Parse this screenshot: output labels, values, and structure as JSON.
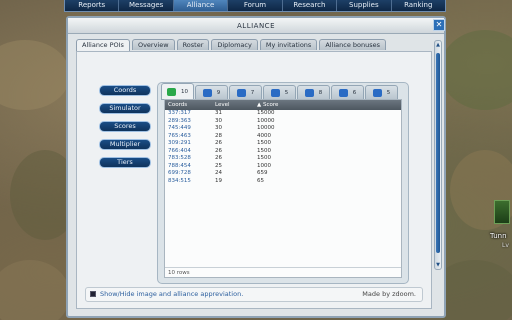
{
  "nav": {
    "tabs": [
      "Reports",
      "Messages",
      "Alliance",
      "Forum",
      "Research",
      "Supplies",
      "Ranking"
    ],
    "active_index": 2
  },
  "window": {
    "title": "ALLIANCE",
    "close_glyph": "✕"
  },
  "main_tabs": [
    {
      "label": "Alliance POIs",
      "active": true
    },
    {
      "label": "Overview",
      "active": false
    },
    {
      "label": "Roster",
      "active": false
    },
    {
      "label": "Diplomacy",
      "active": false
    },
    {
      "label": "My invitations",
      "active": false
    },
    {
      "label": "Alliance bonuses",
      "active": false
    }
  ],
  "side_buttons": [
    "Coords",
    "Simulator",
    "Scores",
    "Multiplier",
    "Tiers"
  ],
  "poi_tabs": [
    {
      "icon": "tiberium-icon",
      "count": "10",
      "color": "#2aa84a",
      "active": true
    },
    {
      "icon": "crystal-icon",
      "count": "9",
      "color": "#2a6bc4",
      "active": false
    },
    {
      "icon": "reactor-icon",
      "count": "7",
      "color": "#2a6bc4",
      "active": false
    },
    {
      "icon": "infantry-icon",
      "count": "5",
      "color": "#2a6bc4",
      "active": false
    },
    {
      "icon": "vehicle-icon",
      "count": "8",
      "color": "#2a6bc4",
      "active": false
    },
    {
      "icon": "aircraft-icon",
      "count": "6",
      "color": "#2a6bc4",
      "active": false
    },
    {
      "icon": "defense-icon",
      "count": "5",
      "color": "#2a6bc4",
      "active": false
    }
  ],
  "grid": {
    "headers": [
      "Coords",
      "Level",
      "▲ Score"
    ],
    "rows": [
      [
        "337:317",
        "31",
        "15000"
      ],
      [
        "289:363",
        "30",
        "10000"
      ],
      [
        "745:449",
        "30",
        "10000"
      ],
      [
        "765:463",
        "28",
        "4000"
      ],
      [
        "309:291",
        "26",
        "1500"
      ],
      [
        "766:404",
        "26",
        "1500"
      ],
      [
        "783:528",
        "26",
        "1500"
      ],
      [
        "788:454",
        "25",
        "1000"
      ],
      [
        "699:728",
        "24",
        "659"
      ],
      [
        "834:515",
        "19",
        "65"
      ]
    ],
    "footer": "10 rows"
  },
  "footer": {
    "checkbox_label": "Show/Hide image and alliance appreviation.",
    "credit": "Made by zdoom."
  },
  "map": {
    "label": "Tunn",
    "sub": "Lv"
  }
}
